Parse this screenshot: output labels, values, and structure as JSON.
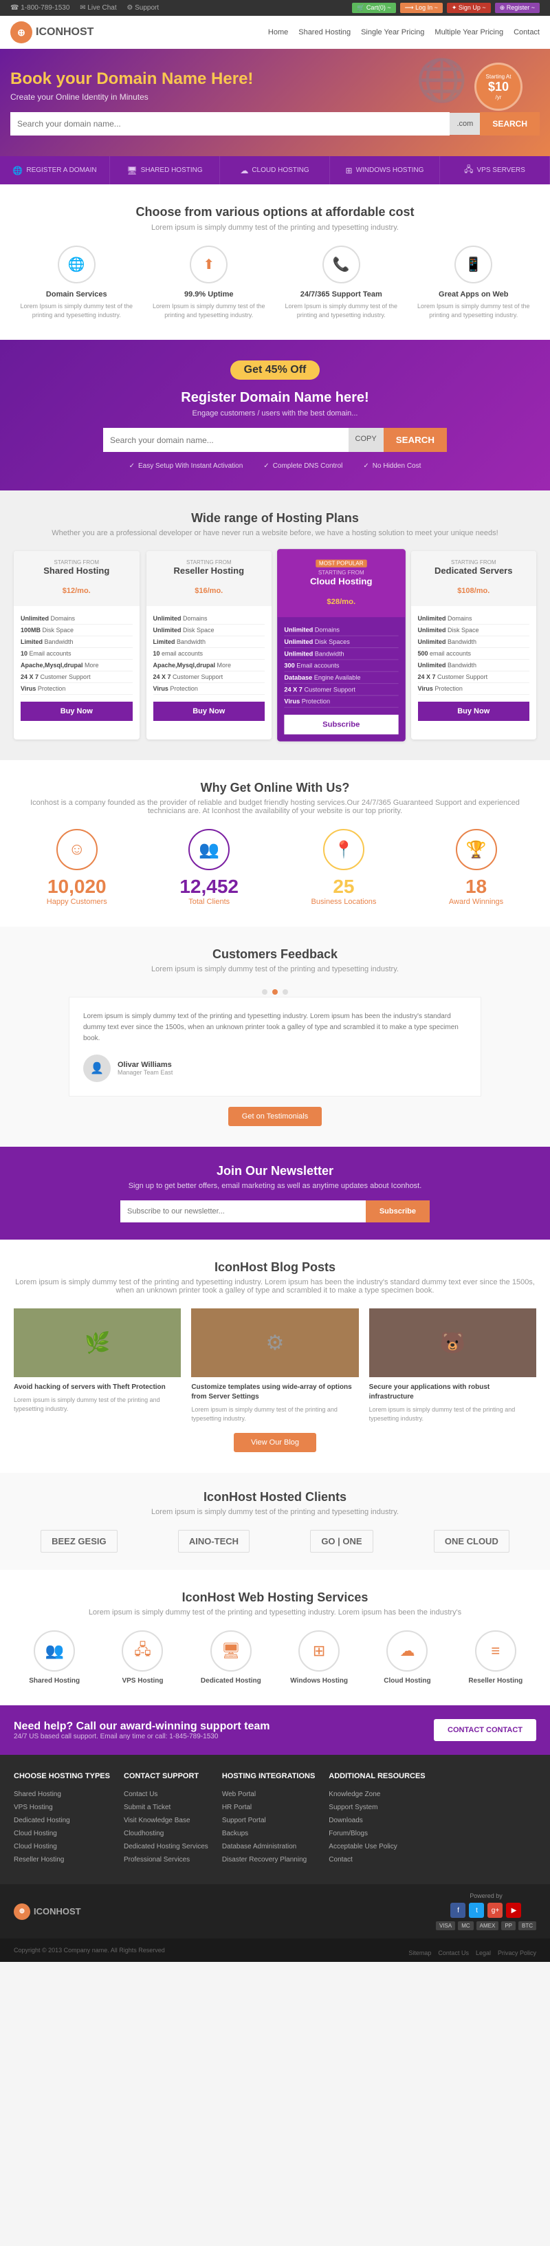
{
  "topbar": {
    "phone": "☎ 1-800-789-1530",
    "chat": "✉ Live Chat",
    "support": "⚙ Support",
    "btn_cart": "🛒 Cart(0) ~",
    "btn_login": "⟶ Log In ~",
    "btn_signup": "✦ Sign Up ~",
    "btn_register": "⊕ Register ~"
  },
  "header": {
    "logo_text": "ICON",
    "logo_span": "HOST",
    "nav": [
      "Home",
      "Shared Hosting",
      "Single Year Pricing",
      "Multiple Year Pricing",
      "Contact"
    ]
  },
  "hero": {
    "title_normal": "Book",
    "title_highlight": " your Domain Name Here!",
    "subtitle": "Create your Online Identity in Minutes",
    "search_placeholder": "Search your domain name...",
    "search_ext": ".com",
    "search_btn": "SEARCH",
    "badge_starting": "Starting At",
    "badge_price": "$10",
    "badge_per": "/yr"
  },
  "subnav": {
    "items": [
      {
        "icon": "🌐",
        "label": "REGISTER A DOMAIN"
      },
      {
        "icon": "🖥",
        "label": "SHARED HOSTING"
      },
      {
        "icon": "☁",
        "label": "CLOUD HOSTING"
      },
      {
        "icon": "⊞",
        "label": "WINDOWS HOSTING"
      },
      {
        "icon": "🖧",
        "label": "VPS SERVERS"
      }
    ]
  },
  "features": {
    "title": "Choose from various options at affordable cost",
    "subtitle": "Lorem ipsum is simply dummy test of the printing and typesetting industry.",
    "items": [
      {
        "icon": "🌐",
        "title": "Domain Services",
        "desc": "Lorem Ipsum is simply dummy test of the printing and typesetting industry."
      },
      {
        "icon": "⬆",
        "title": "99.9% Uptime",
        "desc": "Lorem Ipsum is simply dummy test of the printing and typesetting industry."
      },
      {
        "icon": "📞",
        "title": "24/7/365 Support Team",
        "desc": "Lorem Ipsum is simply dummy test of the printing and typesetting industry."
      },
      {
        "icon": "📱",
        "title": "Great Apps on Web",
        "desc": "Lorem Ipsum is simply dummy test of the printing and typesetting industry."
      }
    ]
  },
  "domain_banner": {
    "badge": "Get 45% Off",
    "title": "Register Domain Name here!",
    "subtitle": "Engage customers / users with the best domain...",
    "search_placeholder": "Search your domain name...",
    "search_ext": "COPY",
    "search_btn": "SEARCH",
    "features": [
      "Easy Setup With Instant Activation",
      "Complete DNS Control",
      "No Hidden Cost"
    ]
  },
  "plans": {
    "title": "Wide range of Hosting Plans",
    "subtitle": "Whether you are a professional developer or have never run a website before, we have a hosting solution to meet your unique needs!",
    "cards": [
      {
        "name": "Shared Hosting",
        "featured": false,
        "badge": "",
        "starting_from": "STARTING FROM",
        "price": "$12",
        "period": "/mo.",
        "features": [
          {
            "label": "Unlimited",
            "desc": "Domains"
          },
          {
            "label": "100MB",
            "desc": "Disk Space"
          },
          {
            "label": "Limited",
            "desc": "Bandwidth"
          },
          {
            "label": "10",
            "desc": "Email accounts"
          },
          {
            "label": "Apache,Mysql,drupal",
            "desc": "More"
          },
          {
            "label": "24 X 7",
            "desc": "Customer Support"
          },
          {
            "label": "Virus",
            "desc": "Protection"
          }
        ],
        "btn": "Buy Now"
      },
      {
        "name": "Reseller Hosting",
        "featured": false,
        "badge": "",
        "starting_from": "STARTING FROM",
        "price": "$16",
        "period": "/mo.",
        "features": [
          {
            "label": "Unlimited",
            "desc": "Domains"
          },
          {
            "label": "Unlimited",
            "desc": "Disk Space"
          },
          {
            "label": "Limited",
            "desc": "Bandwidth"
          },
          {
            "label": "10",
            "desc": "email accounts"
          },
          {
            "label": "Apache,Mysql,drupal",
            "desc": "More"
          },
          {
            "label": "24 X 7",
            "desc": "Customer Support"
          },
          {
            "label": "Virus",
            "desc": "Protection"
          }
        ],
        "btn": "Buy Now"
      },
      {
        "name": "Cloud Hosting",
        "featured": true,
        "badge": "MOST POPULAR",
        "starting_from": "STARTING FROM",
        "price": "$28",
        "period": "/mo.",
        "features": [
          {
            "label": "Unlimited",
            "desc": "Domains"
          },
          {
            "label": "Unlimited",
            "desc": "Disk Spaces"
          },
          {
            "label": "Unlimited",
            "desc": "Bandwidth"
          },
          {
            "label": "300",
            "desc": "Email accounts"
          },
          {
            "label": "Database",
            "desc": "Engine Available"
          },
          {
            "label": "24 X 7",
            "desc": "Customer Support"
          },
          {
            "label": "Virus",
            "desc": "Protection"
          }
        ],
        "btn": "Subscribe"
      },
      {
        "name": "Dedicated Servers",
        "featured": false,
        "badge": "",
        "starting_from": "STARTING FROM",
        "price": "$108",
        "period": "/mo.",
        "features": [
          {
            "label": "Unlimited",
            "desc": "Domains"
          },
          {
            "label": "Unlimited",
            "desc": "Disk Space"
          },
          {
            "label": "Unlimited",
            "desc": "Bandwidth"
          },
          {
            "label": "500",
            "desc": "email accounts"
          },
          {
            "label": "Unlimited",
            "desc": "Bandwidth"
          },
          {
            "label": "24 X 7",
            "desc": "Customer Support"
          },
          {
            "label": "Virus",
            "desc": "Protection"
          }
        ],
        "btn": "Buy Now"
      }
    ]
  },
  "stats": {
    "title": "Why Get Online With Us?",
    "subtitle": "Iconhost is a company founded as the provider of reliable and budget friendly hosting services.Our 24/7/365 Guaranteed Support and experienced technicians are. At Iconhost the availability of your website is our top priority.",
    "items": [
      {
        "icon": "☺",
        "number": "10,020",
        "label": "Happy",
        "label2": "Customers",
        "color": "orange"
      },
      {
        "icon": "👥",
        "number": "12,452",
        "label": "Total",
        "label2": "Clients",
        "color": "purple"
      },
      {
        "icon": "📍",
        "number": "25",
        "label": "Business",
        "label2": "Locations",
        "color": "green"
      },
      {
        "icon": "🏆",
        "number": "18",
        "label": "Award",
        "label2": "Winnings",
        "color": "orange"
      }
    ]
  },
  "testimonials": {
    "title": "Customers Feedback",
    "subtitle": "Lorem ipsum is simply dummy test of the printing and typesetting industry.",
    "text": "Lorem ipsum is simply dummy text of the printing and typesetting industry. Lorem ipsum has been the industry's standard dummy text ever since the 1500s, when an unknown printer took a galley of type and scrambled it to make a type specimen book.",
    "author_name": "Olivar Williams",
    "author_role": "Manager Team East",
    "followme_btn": "Get on Testimonials",
    "dots": 3,
    "active_dot": 1
  },
  "newsletter": {
    "title": "Join Our Newsletter",
    "subtitle": "Sign up to get better offers, email marketing as well as anytime updates about Iconhost.",
    "placeholder": "Subscribe to our newsletter...",
    "btn": "Subscribe"
  },
  "blog": {
    "title": "IconHost Blog Posts",
    "subtitle": "Lorem ipsum is simply dummy test of the printing and typesetting industry. Lorem ipsum has been the industry's standard dummy text ever since the 1500s, when an unknown printer took a galley of type and scrambled it to make a type specimen book.",
    "posts": [
      {
        "title": "Avoid hacking of servers with Theft Protection",
        "desc": "Lorem ipsum is simply dummy test of the printing and typesetting industry."
      },
      {
        "title": "Customize templates using wide-array of options from Server Settings",
        "desc": "Lorem ipsum is simply dummy test of the printing and typesetting industry."
      },
      {
        "title": "Secure your applications with robust infrastructure",
        "desc": "Lorem ipsum is simply dummy test of the printing and typesetting industry."
      }
    ],
    "btn": "View Our Blog"
  },
  "clients": {
    "title": "IconHost Hosted Clients",
    "subtitle": "Lorem ipsum is simply dummy test of the printing and typesetting industry.",
    "logos": [
      "BEEZ GESIG",
      "AINO-TECH",
      "GO | ONE",
      "ONE CLOUD"
    ]
  },
  "hosting_services": {
    "title": "IconHost Web Hosting Services",
    "subtitle": "Lorem ipsum is simply dummy test of the printing and typesetting industry. Lorem ipsum has been the industry's",
    "items": [
      {
        "icon": "👥",
        "label": "Shared Hosting"
      },
      {
        "icon": "🖧",
        "label": "VPS Hosting"
      },
      {
        "icon": "🖥",
        "label": "Dedicated Hosting"
      },
      {
        "icon": "⊞",
        "label": "Windows Hosting"
      },
      {
        "icon": "☁",
        "label": "Cloud Hosting"
      },
      {
        "icon": "≡",
        "label": "Reseller Hosting"
      }
    ]
  },
  "cta_banner": {
    "title": "Need help? Call our award-winning support team",
    "subtitle": "24/7 US based call support. Email any time or call: 1-845-789-1530",
    "btn": "CONTACT CONTACT"
  },
  "footer": {
    "cols": [
      {
        "title": "Choose Hosting Types",
        "links": [
          "Shared Hosting",
          "VPS Hosting",
          "Dedicated Hosting",
          "Cloud Hosting",
          "Cloud Hosting",
          "Reseller Hosting"
        ]
      },
      {
        "title": "Contact Support",
        "links": [
          "Contact Us",
          "Submit a Ticket",
          "Visit Knowledge Base",
          "Cloudhosting",
          "Dedicated Hosting Services",
          "Professional Services"
        ]
      },
      {
        "title": "Hosting Integrations",
        "links": [
          "Web Portal",
          "HR Portal",
          "Support Portal",
          "Backups",
          "Database Administration",
          "Disaster Recovery Planning"
        ]
      },
      {
        "title": "Additional Resources",
        "links": [
          "Knowledge Zone",
          "Support System",
          "Downloads",
          "Forum/Blogs",
          "Acceptable Use Policy",
          "Contact"
        ]
      }
    ],
    "logo_text": "ICON",
    "logo_span": "HOST",
    "copyright": "Copyright © 2013 Company name. All Rights Reserved",
    "links": [
      "Sitemap",
      "Contact Us",
      "Legal",
      "Privacy Policy"
    ],
    "social": [
      "f",
      "t",
      "g+",
      "▶"
    ],
    "payment_icons": [
      "VISA",
      "MC",
      "AMEX",
      "PP",
      "BTC"
    ]
  }
}
